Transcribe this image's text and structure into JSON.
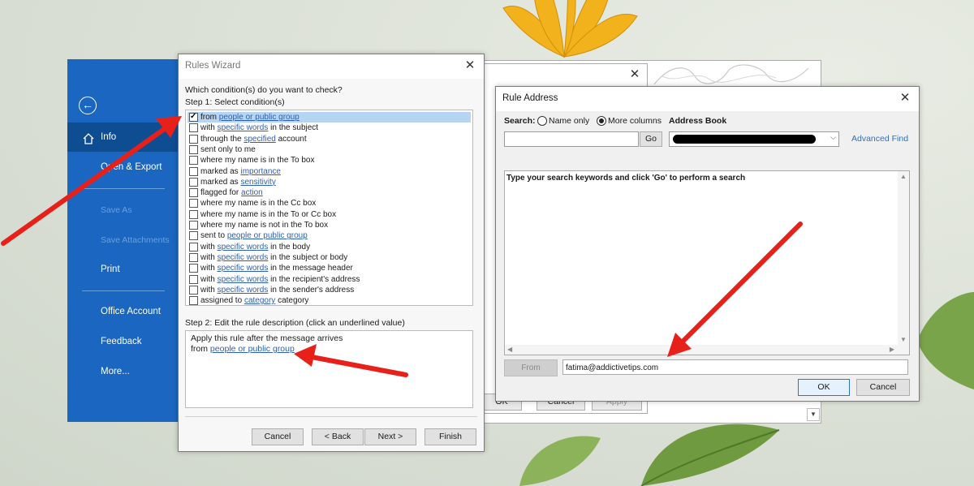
{
  "backstage": {
    "items": [
      {
        "label": "Info"
      },
      {
        "label": "Open & Export"
      },
      {
        "label": "Save As"
      },
      {
        "label": "Save Attachments"
      },
      {
        "label": "Print"
      },
      {
        "label": "Office Account"
      },
      {
        "label": "Feedback"
      },
      {
        "label": "More..."
      }
    ]
  },
  "rules_wizard": {
    "title": "Rules Wizard",
    "question": "Which condition(s) do you want to check?",
    "step1": "Step 1: Select condition(s)",
    "conditions": [
      {
        "pre": "from ",
        "link": "people or public group",
        "post": "",
        "checked": true
      },
      {
        "pre": "with ",
        "link": "specific words",
        "post": " in the subject",
        "checked": false
      },
      {
        "pre": "through the ",
        "link": "specified",
        "post": " account",
        "checked": false
      },
      {
        "pre": "sent only to me",
        "link": "",
        "post": "",
        "checked": false
      },
      {
        "pre": "where my name is in the To box",
        "link": "",
        "post": "",
        "checked": false
      },
      {
        "pre": "marked as ",
        "link": "importance",
        "post": "",
        "checked": false
      },
      {
        "pre": "marked as ",
        "link": "sensitivity",
        "post": "",
        "checked": false
      },
      {
        "pre": "flagged for ",
        "link": "action",
        "post": "",
        "checked": false
      },
      {
        "pre": "where my name is in the Cc box",
        "link": "",
        "post": "",
        "checked": false
      },
      {
        "pre": "where my name is in the To or Cc box",
        "link": "",
        "post": "",
        "checked": false
      },
      {
        "pre": "where my name is not in the To box",
        "link": "",
        "post": "",
        "checked": false
      },
      {
        "pre": "sent to ",
        "link": "people or public group",
        "post": "",
        "checked": false
      },
      {
        "pre": "with ",
        "link": "specific words",
        "post": " in the body",
        "checked": false
      },
      {
        "pre": "with ",
        "link": "specific words",
        "post": " in the subject or body",
        "checked": false
      },
      {
        "pre": "with ",
        "link": "specific words",
        "post": " in the message header",
        "checked": false
      },
      {
        "pre": "with ",
        "link": "specific words",
        "post": " in the recipient's address",
        "checked": false
      },
      {
        "pre": "with ",
        "link": "specific words",
        "post": " in the sender's address",
        "checked": false
      },
      {
        "pre": "assigned to ",
        "link": "category",
        "post": " category",
        "checked": false
      }
    ],
    "step2": "Step 2: Edit the rule description (click an underlined value)",
    "desc_line1": "Apply this rule after the message arrives",
    "desc_line2_pre": "from ",
    "desc_line2_link": "people or public group",
    "buttons": {
      "cancel": "Cancel",
      "back": "< Back",
      "next": "Next >",
      "finish": "Finish"
    }
  },
  "rule_address": {
    "title": "Rule Address",
    "search_label": "Search:",
    "radio_name_only": "Name only",
    "radio_more_columns": "More columns",
    "address_book_label": "Address Book",
    "go_button": "Go",
    "advanced_find": "Advanced Find",
    "results_hint": "Type your search keywords and click 'Go' to perform a search",
    "from_button": "From",
    "from_value": "fatima@addictivetips.com",
    "ok": "OK",
    "cancel": "Cancel"
  },
  "behind_window": {
    "buttons": [
      "OK",
      "Cancel",
      "Apply"
    ]
  },
  "colors": {
    "outlook_blue": "#1a66c0",
    "selected_row": "#b6d5f2",
    "link": "#2f5fb0",
    "arrow_red": "#e8201a"
  }
}
